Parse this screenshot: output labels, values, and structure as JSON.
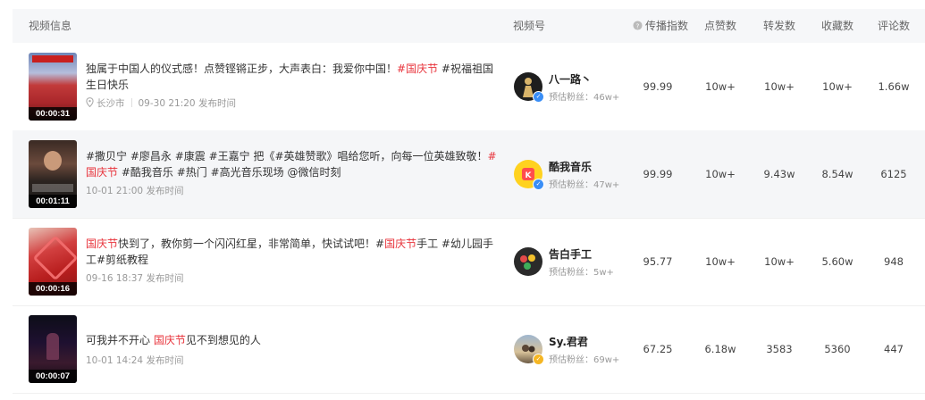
{
  "columns": {
    "video_info": "视频信息",
    "account": "视频号",
    "spread_index": "传播指数",
    "likes": "点赞数",
    "shares": "转发数",
    "favorites": "收藏数",
    "comments": "评论数"
  },
  "colors": {
    "hashtag": "#e8333b",
    "verified": "#3a8ef6"
  },
  "rows": [
    {
      "title_parts": [
        "独属于中国人的仪式感！点赞铿锵正步，大声表白：我爱你中国！",
        "#国庆节",
        " #祝福祖国生日快乐"
      ],
      "location": "长沙市",
      "publish_time": "09-30 21:20 发布时间",
      "duration": "00:00:31",
      "account_name": "八一路丶",
      "account_fans": "预估粉丝：46w+",
      "spread_index": "99.99",
      "likes": "10w+",
      "shares": "10w+",
      "favorites": "10w+",
      "comments": "1.66w"
    },
    {
      "title_parts": [
        "#撒贝宁 #廖昌永 #康震 #王嘉宁 把《#英雄赞歌》唱给您听，向每一位英雄致敬！",
        "#国庆节",
        " #酷我音乐 #热门 #高光音乐现场 @微信时刻"
      ],
      "publish_time": "10-01 21:00 发布时间",
      "duration": "00:01:11",
      "account_name": "酷我音乐",
      "account_fans": "预估粉丝：47w+",
      "spread_index": "99.99",
      "likes": "10w+",
      "shares": "9.43w",
      "favorites": "8.54w",
      "comments": "6125"
    },
    {
      "title_parts": [
        "国庆节",
        "快到了，教你剪一个闪闪红星，非常简单，快试试吧！#",
        "国庆节",
        "手工 #幼儿园手工#剪纸教程"
      ],
      "publish_time": "09-16 18:37 发布时间",
      "duration": "00:00:16",
      "account_name": "告白手工",
      "account_fans": "预估粉丝：5w+",
      "spread_index": "95.77",
      "likes": "10w+",
      "shares": "10w+",
      "favorites": "5.60w",
      "comments": "948"
    },
    {
      "title_parts": [
        "可我并不开心 ",
        "国庆节",
        "见不到想见的人"
      ],
      "publish_time": "10-01 14:24 发布时间",
      "duration": "00:00:07",
      "account_name": "Sy.君君",
      "account_fans": "预估粉丝：69w+",
      "spread_index": "67.25",
      "likes": "6.18w",
      "shares": "3583",
      "favorites": "5360",
      "comments": "447"
    }
  ]
}
